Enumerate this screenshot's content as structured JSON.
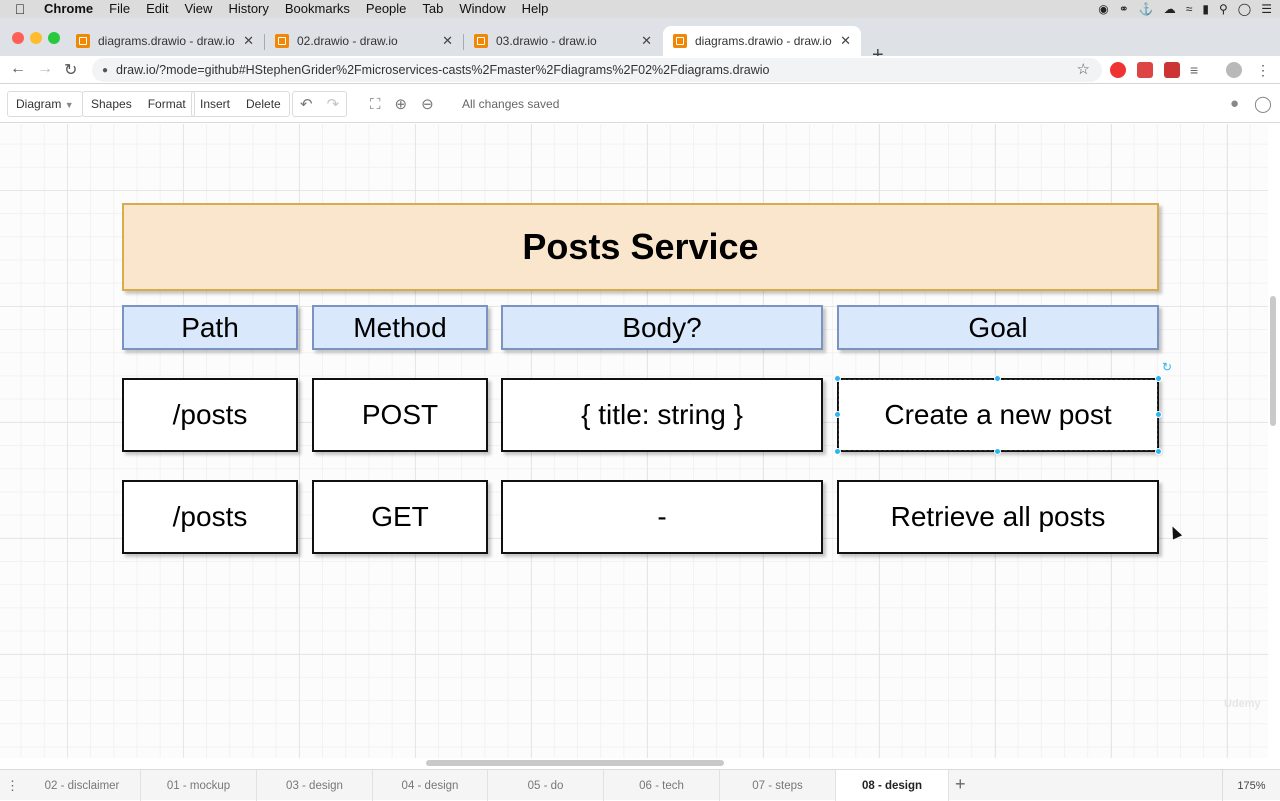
{
  "menubar": {
    "app": "Chrome",
    "items": [
      "File",
      "Edit",
      "View",
      "History",
      "Bookmarks",
      "People",
      "Tab",
      "Window",
      "Help"
    ]
  },
  "tabs": [
    {
      "title": "diagrams.drawio - draw.io",
      "active": false
    },
    {
      "title": "02.drawio - draw.io",
      "active": false
    },
    {
      "title": "03.drawio - draw.io",
      "active": false
    },
    {
      "title": "diagrams.drawio - draw.io",
      "active": true
    }
  ],
  "address": {
    "url": "draw.io/?mode=github#HStephenGrider%2Fmicroservices-casts%2Fmaster%2Fdiagrams%2F02%2Fdiagrams.drawio"
  },
  "drawio_toolbar": {
    "diagram": "Diagram",
    "shapes": "Shapes",
    "format": "Format",
    "insert": "Insert",
    "delete": "Delete",
    "status": "All changes saved"
  },
  "diagram": {
    "title": "Posts Service",
    "headers": [
      "Path",
      "Method",
      "Body?",
      "Goal"
    ],
    "rows": [
      [
        "/posts",
        "POST",
        "{ title: string }",
        "Create a new post"
      ],
      [
        "/posts",
        "GET",
        "-",
        "Retrieve all posts"
      ]
    ],
    "colors": {
      "title_fill": "#fae6cc",
      "header_fill": "#dae8fc",
      "selection": "#29b6f2"
    }
  },
  "watermark": "Udemy",
  "sheets": {
    "items": [
      "02 - disclaimer",
      "01 - mockup",
      "03 - design",
      "04 - design",
      "05 - do",
      "06 - tech",
      "07 - steps",
      "08 - design"
    ],
    "active": "08 - design",
    "zoom": "175%"
  }
}
